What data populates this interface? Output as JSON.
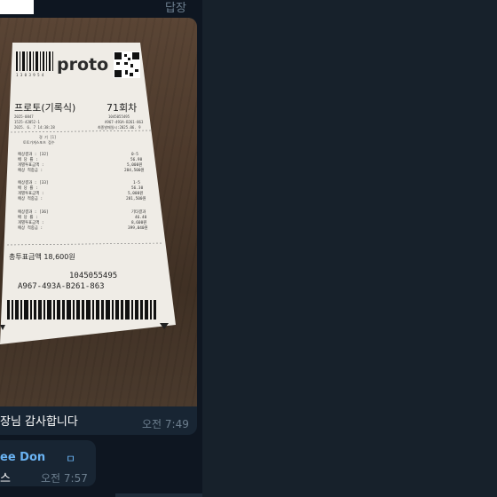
{
  "chat": {
    "reply_label": "답장",
    "caption": "장님 감사합니다",
    "caption_time": "오전 7:49",
    "sender_name": "ee Don",
    "sender_extra": "ㅁ",
    "message": "스",
    "message_time": "오전 7:57"
  },
  "receipt": {
    "barcode_number": "1 3 0 3 9 5 4",
    "brand": "proto",
    "product": "프로토(기록식)",
    "round": "71회차",
    "header_left": [
      "2025-0847",
      "1525-42052-1",
      "2025. 6. 7 14:38:28"
    ],
    "header_right": [
      "1045055495",
      "A967-493A-B261-863",
      "최종발매일시:2025.06. 9"
    ],
    "game_label": "경 기 [1]",
    "game_sub": "토토가게스포츠 점수",
    "blocks": [
      {
        "lines": [
          "예상결과 : [32]",
          "배 당 률 :",
          "개별투표금액 :",
          "예상 적중금 :"
        ],
        "values": [
          "0-5",
          "56.90",
          "5,000원",
          "284,500원"
        ]
      },
      {
        "lines": [
          "예상결과 : [33]",
          "배 당 률 :",
          "개별투표금액 :",
          "예상 적중금 :"
        ],
        "values": [
          "1-5",
          "56.30",
          "5,000원",
          "281,500원"
        ]
      },
      {
        "lines": [
          "예상결과 : [36]",
          "배 당 률 :",
          "개별투표금액 :",
          "예상 적중금 :"
        ],
        "values": [
          "기타결과",
          "46.40",
          "8,600원",
          "399,040원"
        ]
      }
    ],
    "total_label": "총투표금액 18,600원",
    "ticket_number": "1045055495",
    "ticket_code": "A967-493A-B261-863"
  }
}
